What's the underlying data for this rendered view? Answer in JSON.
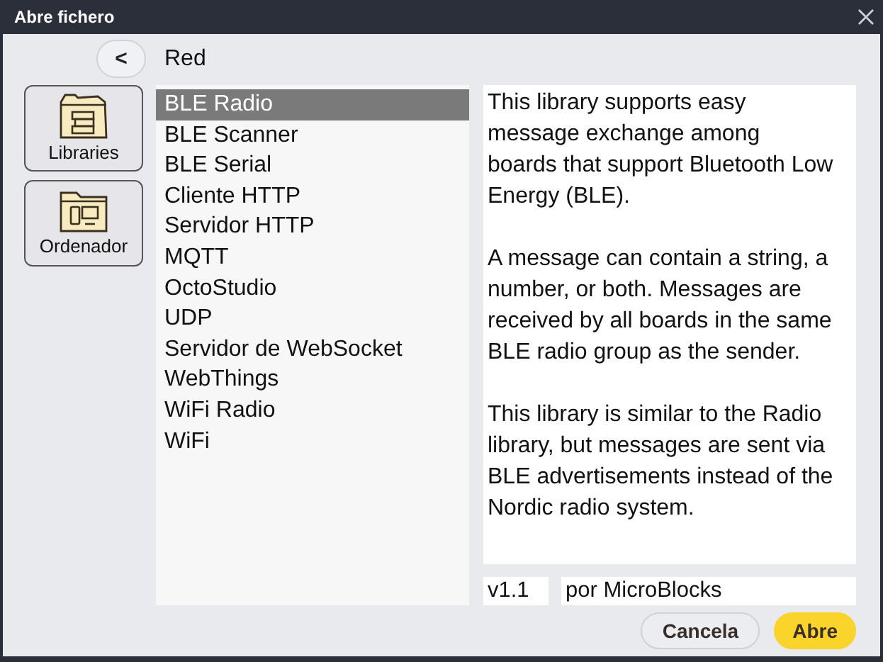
{
  "window": {
    "title": "Abre fichero"
  },
  "back_button": {
    "label": "<"
  },
  "location": "Red",
  "places": [
    {
      "label": "Libraries",
      "kind": "libraries"
    },
    {
      "label": "Ordenador",
      "kind": "computer"
    }
  ],
  "files": [
    {
      "name": "BLE Radio",
      "selected": true
    },
    {
      "name": "BLE Scanner",
      "selected": false
    },
    {
      "name": "BLE Serial",
      "selected": false
    },
    {
      "name": "Cliente HTTP",
      "selected": false
    },
    {
      "name": "Servidor HTTP",
      "selected": false
    },
    {
      "name": "MQTT",
      "selected": false
    },
    {
      "name": "OctoStudio",
      "selected": false
    },
    {
      "name": "UDP",
      "selected": false
    },
    {
      "name": "Servidor de WebSocket",
      "selected": false
    },
    {
      "name": "WebThings",
      "selected": false
    },
    {
      "name": "WiFi Radio",
      "selected": false
    },
    {
      "name": "WiFi",
      "selected": false
    }
  ],
  "description": [
    "This library supports easy message exchange among boards that support Bluetooth Low Energy (BLE).",
    "A message can contain a string, a number, or both. Messages are received by all boards in the same BLE radio group as the sender.",
    "This library is similar to the Radio library, but messages are sent via BLE advertisements instead of the Nordic radio system."
  ],
  "version": "v1.1",
  "author": "por MicroBlocks",
  "buttons": [
    {
      "label": "Cancela",
      "kind": "secondary"
    },
    {
      "label": "Abre",
      "kind": "primary"
    }
  ]
}
